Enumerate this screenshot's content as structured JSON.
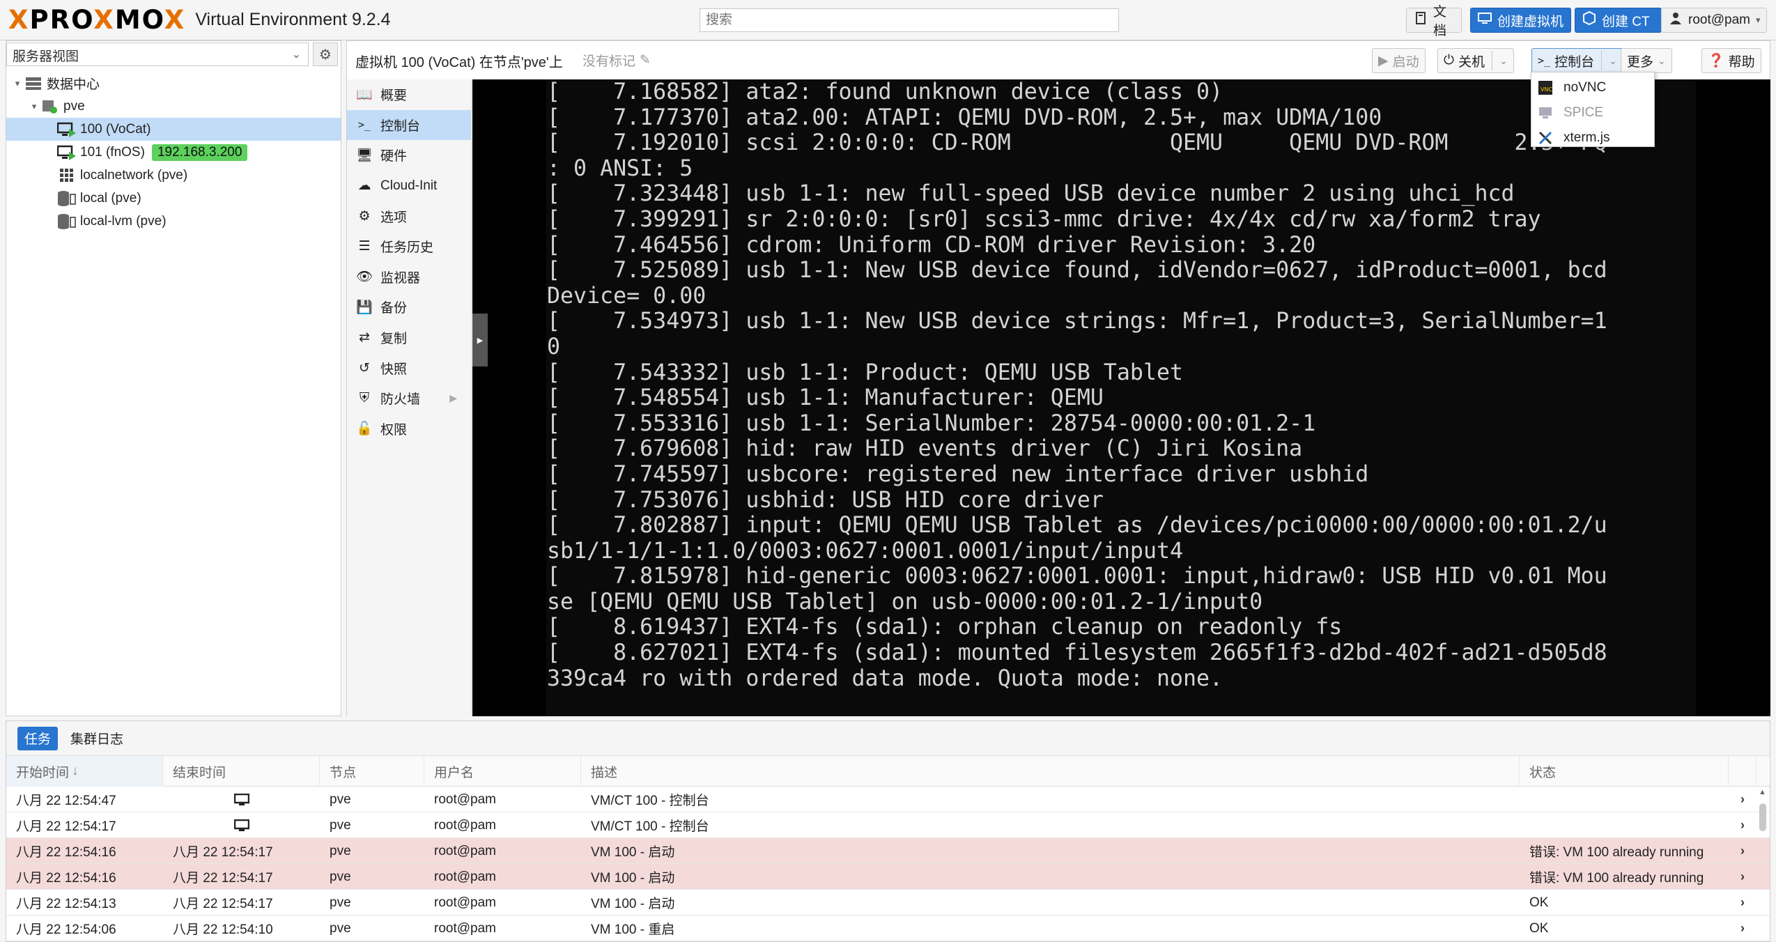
{
  "header": {
    "logo_text": "PROXMOX",
    "product": "Virtual Environment 9.2.4",
    "search_placeholder": "搜索",
    "docs": "文档",
    "create_vm": "创建虚拟机",
    "create_ct": "创建 CT",
    "user": "root@pam"
  },
  "tree": {
    "view": "服务器视图",
    "datacenter": "数据中心",
    "node": "pve",
    "vm100": "100 (VoCat)",
    "vm101": "101 (fnOS)",
    "vm101_ip": "192.168.3.200",
    "network": "localnetwork (pve)",
    "storage_local": "local (pve)",
    "storage_lvm": "local-lvm (pve)"
  },
  "content": {
    "title": "虚拟机 100 (VoCat) 在节点'pve'上",
    "tags": "没有标记",
    "toolbar": {
      "start": "启动",
      "shutdown": "关机",
      "console": "控制台",
      "more": "更多",
      "help": "帮助"
    }
  },
  "subnav": [
    {
      "label": "概要",
      "icon": "book-icon"
    },
    {
      "label": "控制台",
      "icon": "terminal-icon"
    },
    {
      "label": "硬件",
      "icon": "desktop-icon"
    },
    {
      "label": "Cloud-Init",
      "icon": "cloud-icon"
    },
    {
      "label": "选项",
      "icon": "gear-icon"
    },
    {
      "label": "任务历史",
      "icon": "list-icon"
    },
    {
      "label": "监视器",
      "icon": "eye-icon"
    },
    {
      "label": "备份",
      "icon": "floppy-icon"
    },
    {
      "label": "复制",
      "icon": "retweet-icon"
    },
    {
      "label": "快照",
      "icon": "history-icon"
    },
    {
      "label": "防火墙",
      "icon": "shield-icon"
    },
    {
      "label": "权限",
      "icon": "unlock-icon"
    }
  ],
  "console_menu": {
    "novnc": "noVNC",
    "spice": "SPICE",
    "xterm": "xterm.js"
  },
  "terminal_lines": [
    "[    7.168582] ata2: found unknown device (class 0)",
    "[    7.177370] ata2.00: ATAPI: QEMU DVD-ROM, 2.5+, max UDMA/100",
    "[    7.192010] scsi 2:0:0:0: CD-ROM            QEMU     QEMU DVD-ROM     2.5+ PQ",
    ": 0 ANSI: 5",
    "[    7.323448] usb 1-1: new full-speed USB device number 2 using uhci_hcd",
    "[    7.399291] sr 2:0:0:0: [sr0] scsi3-mmc drive: 4x/4x cd/rw xa/form2 tray",
    "[    7.464556] cdrom: Uniform CD-ROM driver Revision: 3.20",
    "[    7.525089] usb 1-1: New USB device found, idVendor=0627, idProduct=0001, bcd",
    "Device= 0.00",
    "[    7.534973] usb 1-1: New USB device strings: Mfr=1, Product=3, SerialNumber=1",
    "0",
    "[    7.543332] usb 1-1: Product: QEMU USB Tablet",
    "[    7.548554] usb 1-1: Manufacturer: QEMU",
    "[    7.553316] usb 1-1: SerialNumber: 28754-0000:00:01.2-1",
    "[    7.679608] hid: raw HID events driver (C) Jiri Kosina",
    "[    7.745597] usbcore: registered new interface driver usbhid",
    "[    7.753076] usbhid: USB HID core driver",
    "[    7.802887] input: QEMU QEMU USB Tablet as /devices/pci0000:00/0000:00:01.2/u",
    "sb1/1-1/1-1:1.0/0003:0627:0001.0001/input/input4",
    "[    7.815978] hid-generic 0003:0627:0001.0001: input,hidraw0: USB HID v0.01 Mou",
    "se [QEMU QEMU USB Tablet] on usb-0000:00:01.2-1/input0",
    "[    8.619437] EXT4-fs (sda1): orphan cleanup on readonly fs",
    "[    8.627021] EXT4-fs (sda1): mounted filesystem 2665f1f3-d2bd-402f-ad21-d505d8",
    "339ca4 ro with ordered data mode. Quota mode: none."
  ],
  "tasks": {
    "tab_tasks": "任务",
    "tab_cluster_log": "集群日志",
    "columns": {
      "start": "开始时间",
      "end": "结束时间",
      "node": "节点",
      "user": "用户名",
      "desc": "描述",
      "status": "状态"
    },
    "rows": [
      {
        "start": "八月 22 12:54:47",
        "end": "",
        "end_icon": "monitor-icon",
        "node": "pve",
        "user": "root@pam",
        "desc": "VM/CT 100 - 控制台",
        "status": "",
        "error": false
      },
      {
        "start": "八月 22 12:54:17",
        "end": "",
        "end_icon": "monitor-icon",
        "node": "pve",
        "user": "root@pam",
        "desc": "VM/CT 100 - 控制台",
        "status": "",
        "error": false
      },
      {
        "start": "八月 22 12:54:16",
        "end": "八月 22 12:54:17",
        "end_icon": "",
        "node": "pve",
        "user": "root@pam",
        "desc": "VM 100 - 启动",
        "status": "错误: VM 100 already running",
        "error": true
      },
      {
        "start": "八月 22 12:54:16",
        "end": "八月 22 12:54:17",
        "end_icon": "",
        "node": "pve",
        "user": "root@pam",
        "desc": "VM 100 - 启动",
        "status": "错误: VM 100 already running",
        "error": true
      },
      {
        "start": "八月 22 12:54:13",
        "end": "八月 22 12:54:17",
        "end_icon": "",
        "node": "pve",
        "user": "root@pam",
        "desc": "VM 100 - 启动",
        "status": "OK",
        "error": false
      },
      {
        "start": "八月 22 12:54:06",
        "end": "八月 22 12:54:10",
        "end_icon": "",
        "node": "pve",
        "user": "root@pam",
        "desc": "VM 100 - 重启",
        "status": "OK",
        "error": false
      }
    ]
  },
  "colors": {
    "accent": "#2875d0",
    "brand_orange": "#e57000",
    "selection": "#c2dcf7",
    "error_row": "#f5dada",
    "ip_badge": "#5cd15c"
  }
}
